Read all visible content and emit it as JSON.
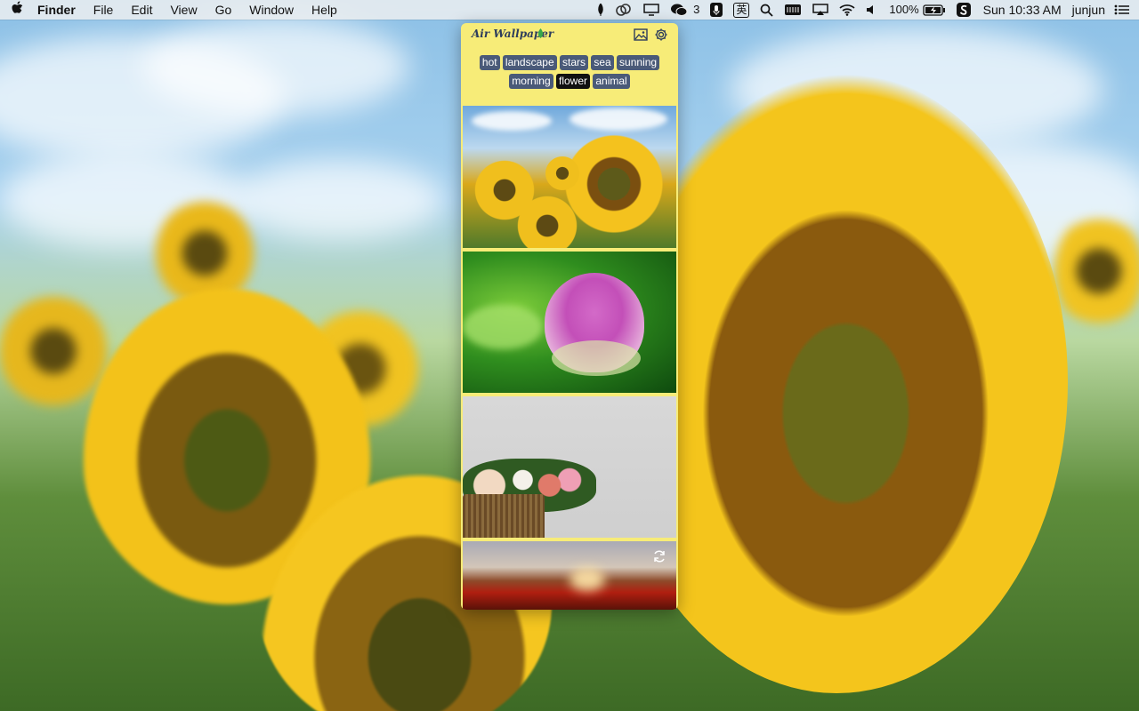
{
  "menubar": {
    "app_name": "Finder",
    "menus": [
      "File",
      "Edit",
      "View",
      "Go",
      "Window",
      "Help"
    ],
    "wechat_badge": "3",
    "ime": "英",
    "battery": "100%",
    "clock": "Sun 10:33 AM",
    "user": "junjun"
  },
  "panel": {
    "title": "Air Wallpaper",
    "tags": [
      {
        "label": "hot"
      },
      {
        "label": "landscape"
      },
      {
        "label": "stars"
      },
      {
        "label": "sea"
      },
      {
        "label": "sunning"
      },
      {
        "label": "morning"
      },
      {
        "label": "flower"
      },
      {
        "label": "animal"
      }
    ],
    "selected_tag": "flower",
    "tag_active_color": "#111111",
    "tag_color": "#4a5a78",
    "background_color": "#f7ec78"
  },
  "icons": [
    "apple-icon",
    "gallery-icon",
    "settings-icon",
    "refresh-icon",
    "search-icon",
    "wifi-icon",
    "volume-icon",
    "battery-icon",
    "airplay-icon",
    "list-icon"
  ]
}
